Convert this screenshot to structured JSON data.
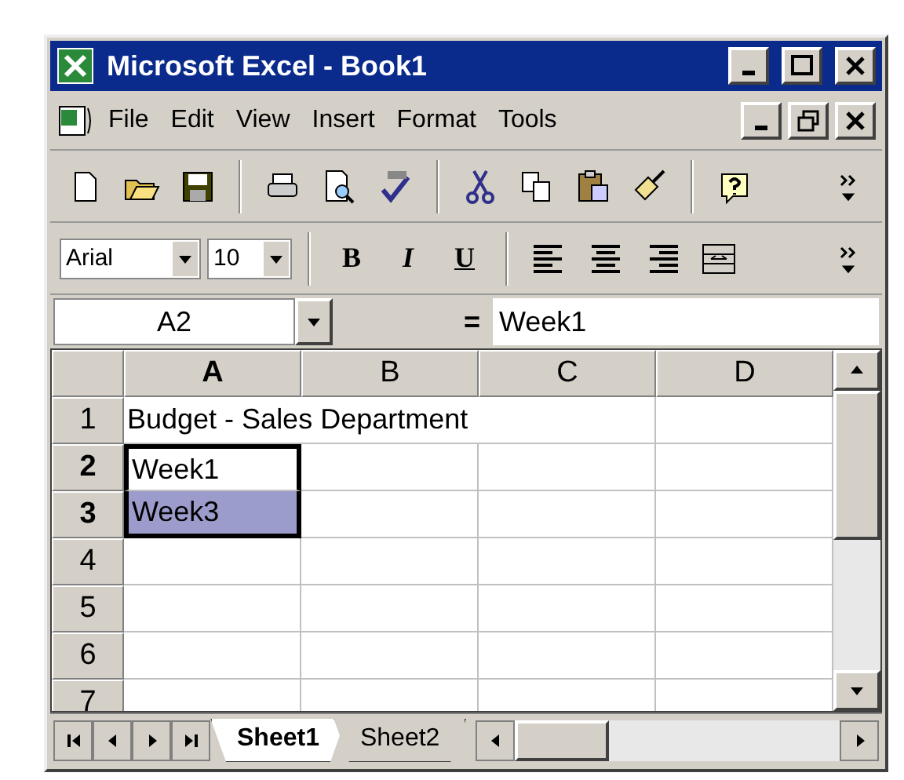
{
  "window": {
    "title": "Microsoft Excel - Book1"
  },
  "menu": [
    {
      "label": "File"
    },
    {
      "label": "Edit"
    },
    {
      "label": "View"
    },
    {
      "label": "Insert"
    },
    {
      "label": "Format"
    },
    {
      "label": "Tools"
    }
  ],
  "formatting": {
    "font": "Arial",
    "size": "10",
    "styles": [
      {
        "label": "B",
        "kind": "bold"
      },
      {
        "label": "I",
        "kind": "italic"
      },
      {
        "label": "U",
        "kind": "underline"
      }
    ]
  },
  "formula_bar": {
    "name_box": "A2",
    "equals": "=",
    "value": "Week1"
  },
  "columns": [
    {
      "label": "A",
      "selected": true
    },
    {
      "label": "B",
      "selected": false
    },
    {
      "label": "C",
      "selected": false
    },
    {
      "label": "D",
      "selected": false
    }
  ],
  "rows": [
    {
      "label": "1",
      "selected": false,
      "cell": {
        "text": "Budget - Sales Department",
        "selected": false,
        "active": false
      }
    },
    {
      "label": "2",
      "selected": true,
      "cell": {
        "text": "Week1",
        "selected": true,
        "active": true
      }
    },
    {
      "label": "3",
      "selected": true,
      "cell": {
        "text": "Week3",
        "selected": true,
        "active": false
      }
    },
    {
      "label": "4",
      "selected": false
    },
    {
      "label": "5",
      "selected": false
    },
    {
      "label": "6",
      "selected": false
    },
    {
      "label": "7",
      "selected": false
    }
  ],
  "sheet_tabs": [
    {
      "label": "Sheet1",
      "selected": true
    },
    {
      "label": "Sheet2",
      "selected": false
    }
  ]
}
